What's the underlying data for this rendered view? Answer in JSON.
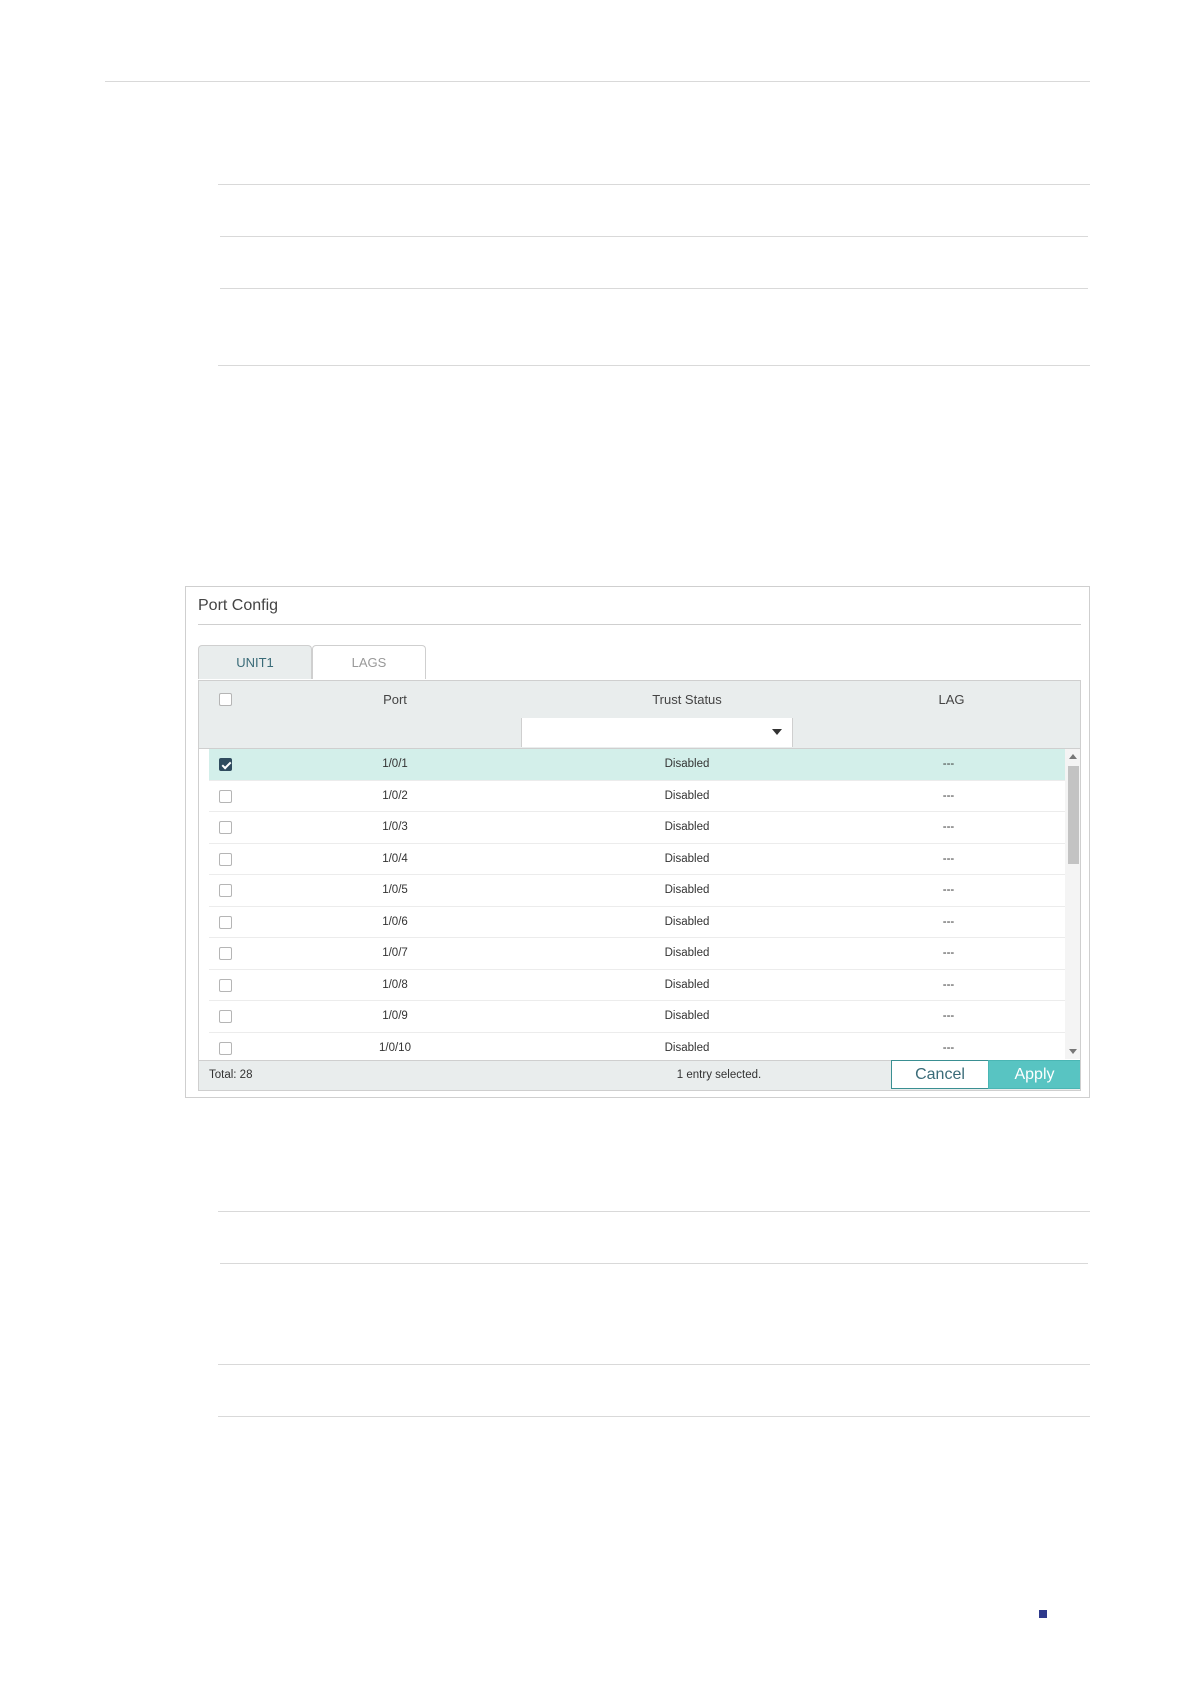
{
  "panel": {
    "title": "Port Config",
    "tabs": [
      {
        "label": "UNIT1",
        "active": true
      },
      {
        "label": "LAGS",
        "active": false
      }
    ],
    "columns": {
      "port": "Port",
      "trust": "Trust Status",
      "lag": "LAG"
    },
    "filter": {
      "trust_value": ""
    },
    "rows": [
      {
        "port": "1/0/1",
        "trust": "Disabled",
        "lag": "---",
        "checked": true
      },
      {
        "port": "1/0/2",
        "trust": "Disabled",
        "lag": "---",
        "checked": false
      },
      {
        "port": "1/0/3",
        "trust": "Disabled",
        "lag": "---",
        "checked": false
      },
      {
        "port": "1/0/4",
        "trust": "Disabled",
        "lag": "---",
        "checked": false
      },
      {
        "port": "1/0/5",
        "trust": "Disabled",
        "lag": "---",
        "checked": false
      },
      {
        "port": "1/0/6",
        "trust": "Disabled",
        "lag": "---",
        "checked": false
      },
      {
        "port": "1/0/7",
        "trust": "Disabled",
        "lag": "---",
        "checked": false
      },
      {
        "port": "1/0/8",
        "trust": "Disabled",
        "lag": "---",
        "checked": false
      },
      {
        "port": "1/0/9",
        "trust": "Disabled",
        "lag": "---",
        "checked": false
      },
      {
        "port": "1/0/10",
        "trust": "Disabled",
        "lag": "---",
        "checked": false
      }
    ],
    "footer": {
      "total": "Total: 28",
      "selected": "1 entry selected.",
      "cancel_label": "Cancel",
      "apply_label": "Apply"
    }
  },
  "colors": {
    "accent": "#58c4c2",
    "selected_row": "#d3efea",
    "header_bg": "#e9eded",
    "checkbox_checked": "#2f4b5e",
    "page_marker": "#2e3a8c"
  }
}
